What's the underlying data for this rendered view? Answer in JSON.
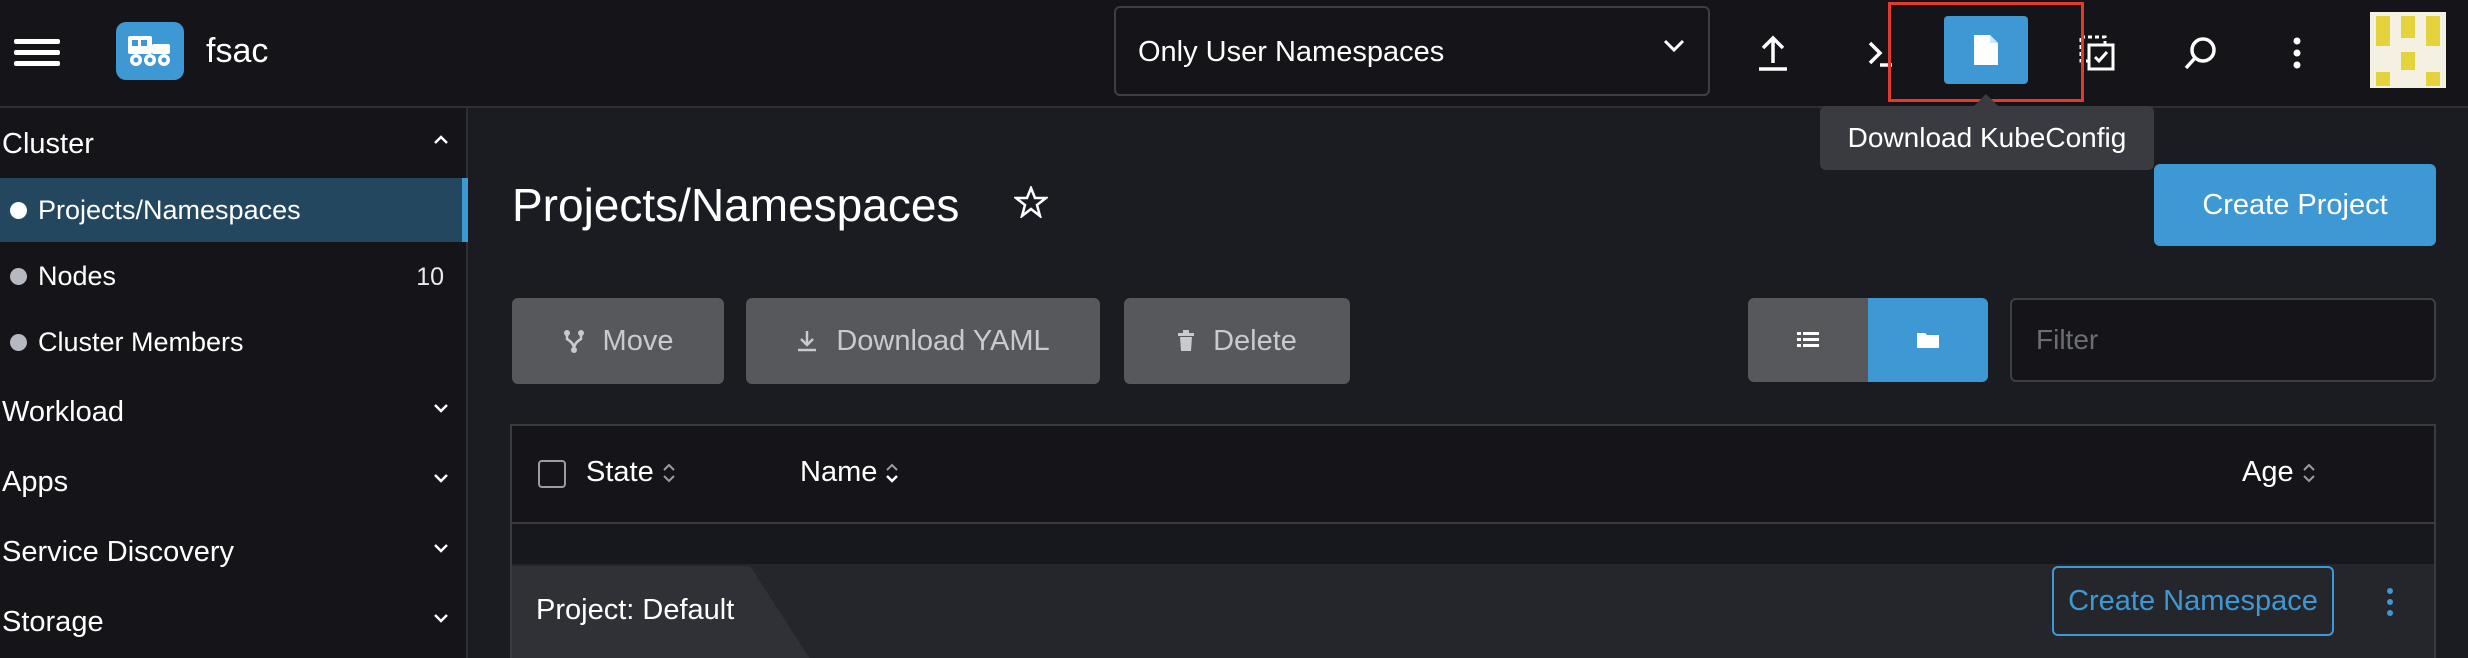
{
  "header": {
    "cluster_name": "fsac",
    "namespace_filter": "Only User Namespaces",
    "tooltip": "Download KubeConfig",
    "icons": [
      "menu-icon",
      "cluster-logo-icon",
      "upload-icon",
      "kubectl-shell-icon",
      "file-icon",
      "copy-kubeconfig-icon",
      "search-icon",
      "kebab-icon"
    ],
    "highlight_color": "#e33a2f"
  },
  "sidebar": {
    "groups": {
      "cluster": "Cluster",
      "workload": "Workload",
      "apps": "Apps",
      "service_discovery": "Service Discovery",
      "storage": "Storage"
    },
    "items": [
      {
        "label": "Projects/Namespaces",
        "count": "",
        "active": true
      },
      {
        "label": "Nodes",
        "count": "10",
        "active": false
      },
      {
        "label": "Cluster Members",
        "count": "",
        "active": false
      }
    ]
  },
  "main": {
    "title": "Projects/Namespaces",
    "create_project": "Create Project",
    "actions": {
      "move": "Move",
      "download_yaml": "Download YAML",
      "delete": "Delete"
    },
    "filter_placeholder": "Filter",
    "table": {
      "columns": {
        "state": "State",
        "name": "Name",
        "age": "Age"
      },
      "group_label": "Project: Default",
      "create_namespace": "Create Namespace"
    }
  },
  "colors": {
    "accent": "#3d98d3",
    "background": "#1b1c21",
    "panel": "#141419",
    "button_disabled": "#57585c"
  }
}
